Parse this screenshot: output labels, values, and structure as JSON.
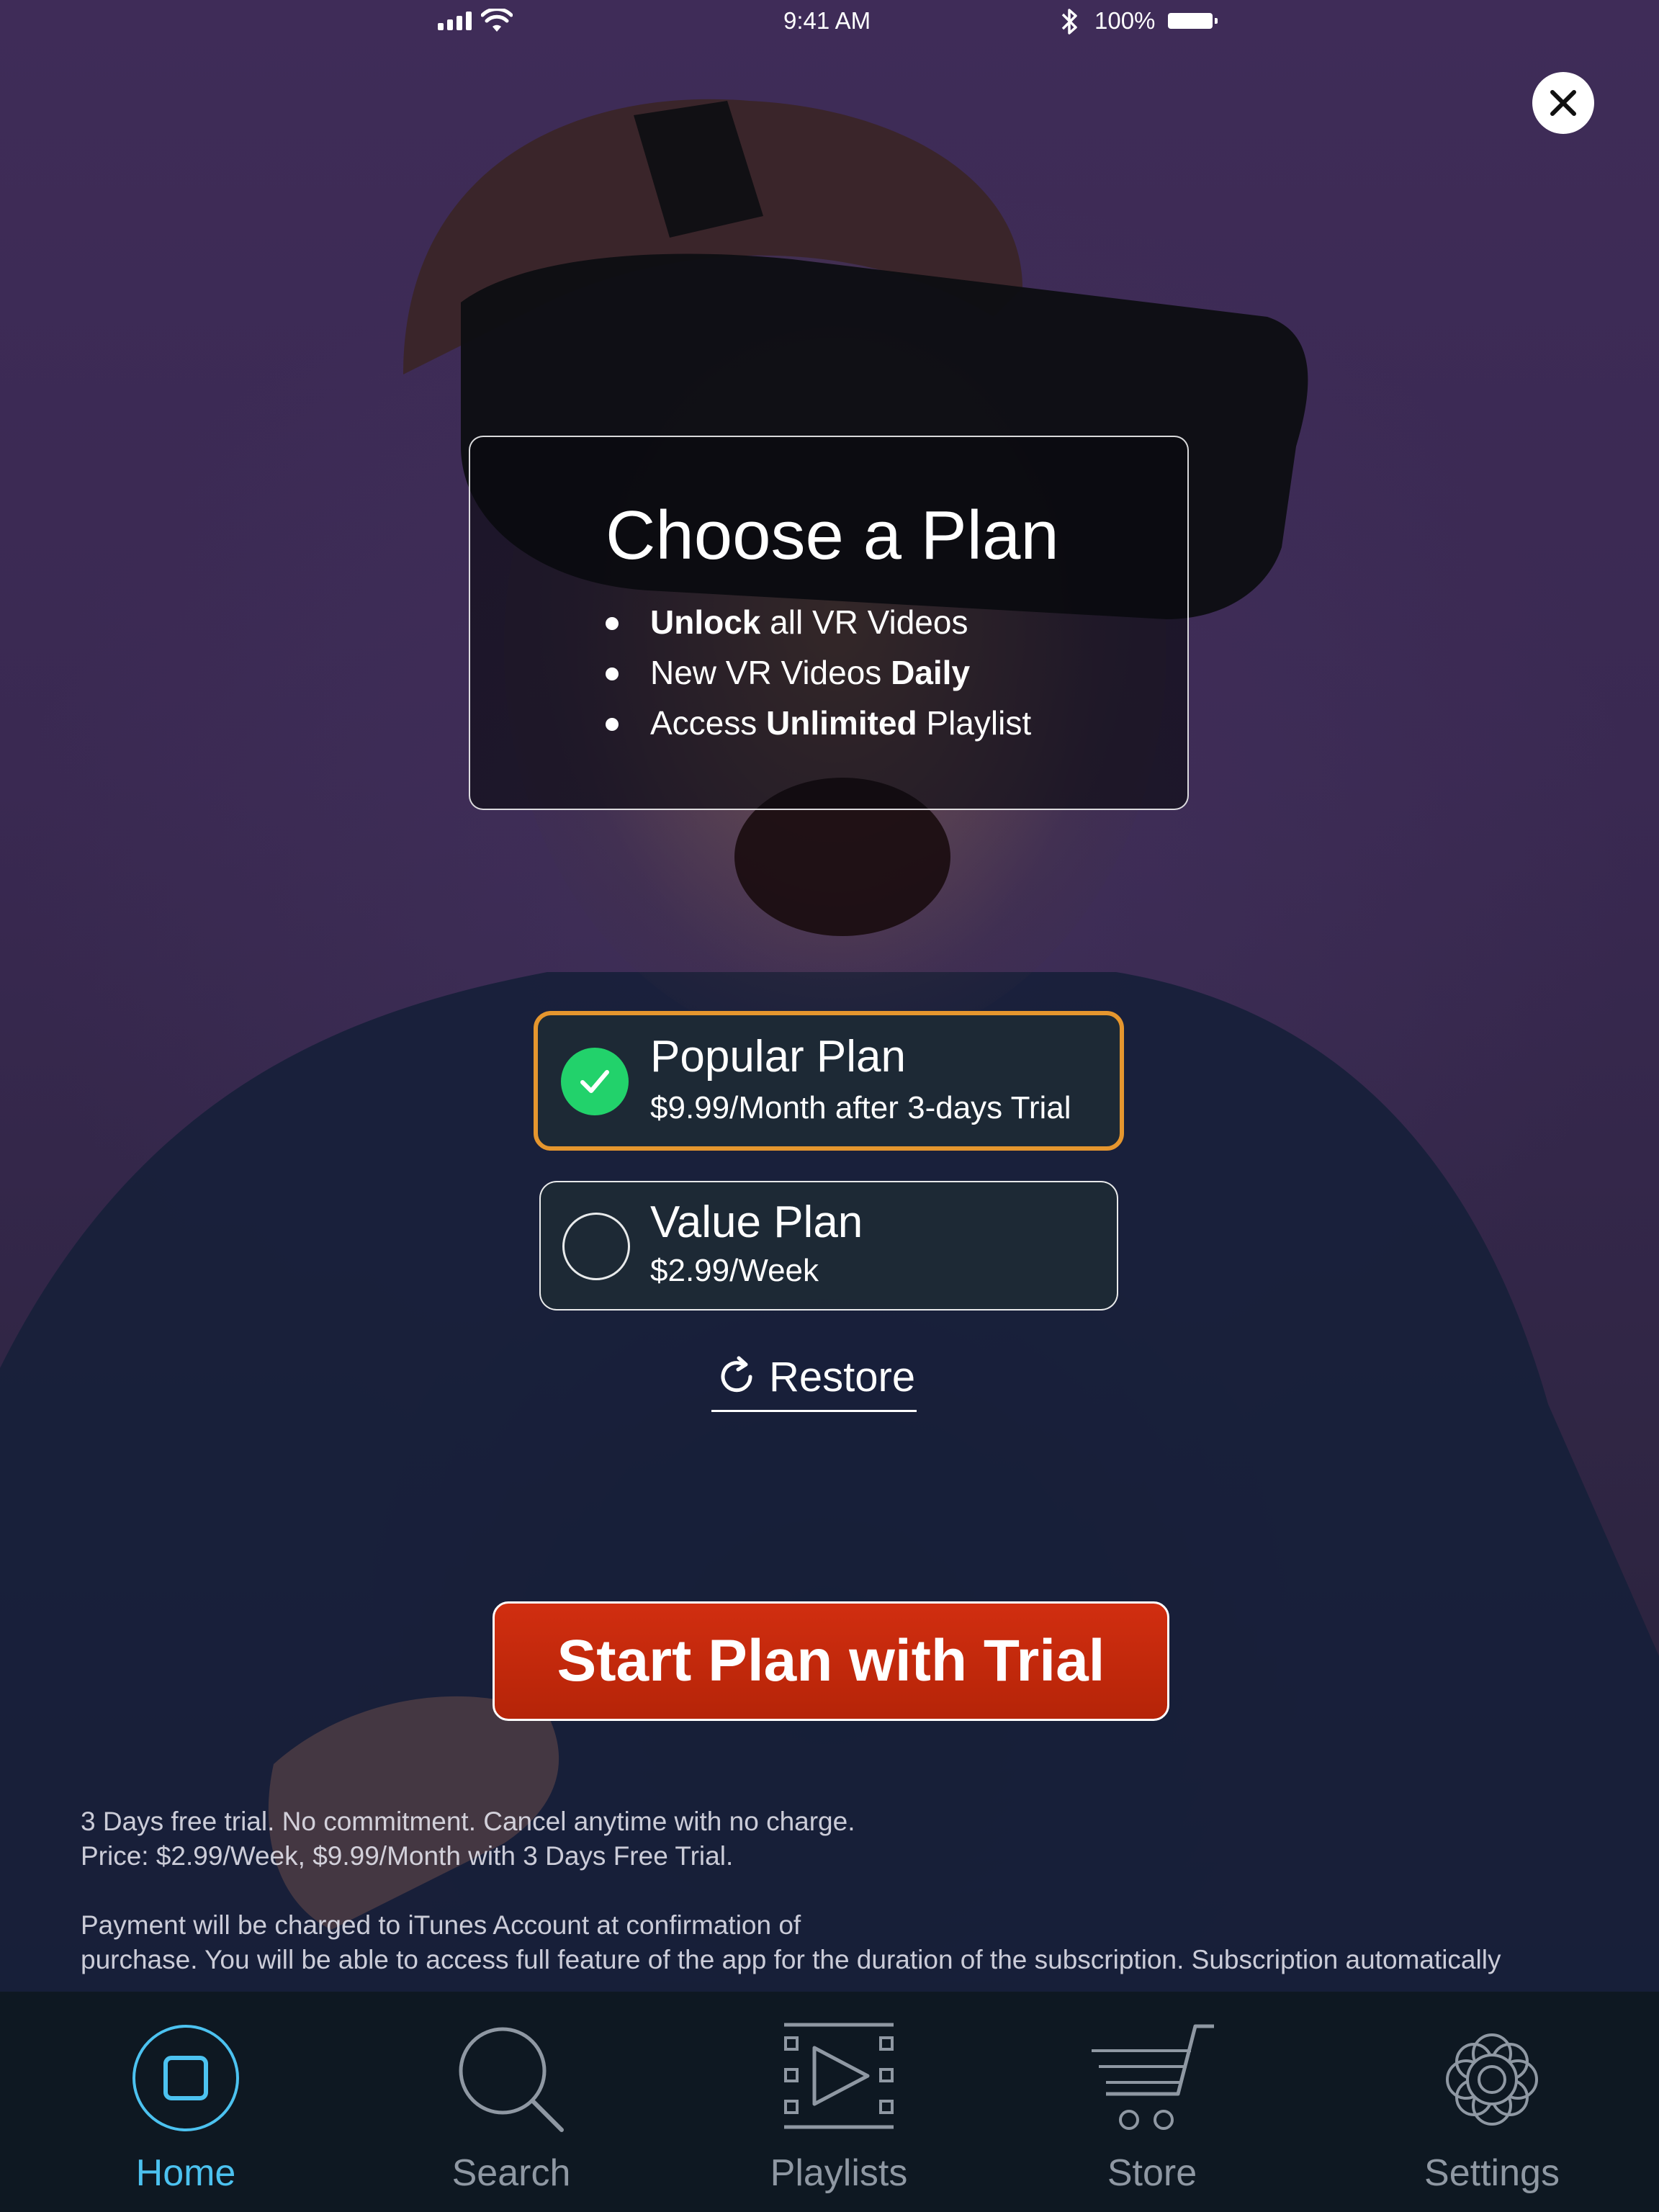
{
  "status_bar": {
    "time": "9:41 AM",
    "battery": "100%"
  },
  "header": {
    "close_label": "X"
  },
  "plan_card": {
    "title": "Choose a Plan",
    "features": [
      {
        "strong": "Unlock",
        "rest": " all VR Videos"
      },
      {
        "lead": "New VR Videos ",
        "strong": "Daily"
      },
      {
        "lead": "Access ",
        "strong": "Unlimited",
        "rest": " Playlist"
      }
    ]
  },
  "plans": [
    {
      "name": "Popular Plan",
      "price": "$9.99/Month after 3-days Trial",
      "selected": true
    },
    {
      "name": "Value Plan",
      "price": "$2.99/Week",
      "selected": false
    }
  ],
  "restore_label": "Restore",
  "cta_label": "Start Plan with Trial",
  "legal": {
    "line1": "3 Days free trial. No commitment. Cancel anytime with no charge.",
    "line2": "Price: $2.99/Week, $9.99/Month with 3 Days Free Trial.",
    "line3": "Payment will be charged to iTunes Account at confirmation of",
    "line4": "purchase. You will be able to access full feature of the app for the duration of the subscription. Subscription automatically"
  },
  "tabs": [
    {
      "label": "Home",
      "icon": "home-icon",
      "active": true
    },
    {
      "label": "Search",
      "icon": "search-icon",
      "active": false
    },
    {
      "label": "Playlists",
      "icon": "playlists-icon",
      "active": false
    },
    {
      "label": "Store",
      "icon": "cart-icon",
      "active": false
    },
    {
      "label": "Settings",
      "icon": "gear-icon",
      "active": false
    }
  ],
  "colors": {
    "accent_selected_border": "#e5962e",
    "check_green": "#22d26b",
    "cta_red": "#c32a0c",
    "tab_active": "#4cc2f0",
    "tab_inactive": "#8f98a3",
    "tabbar_bg": "#0e1822"
  }
}
